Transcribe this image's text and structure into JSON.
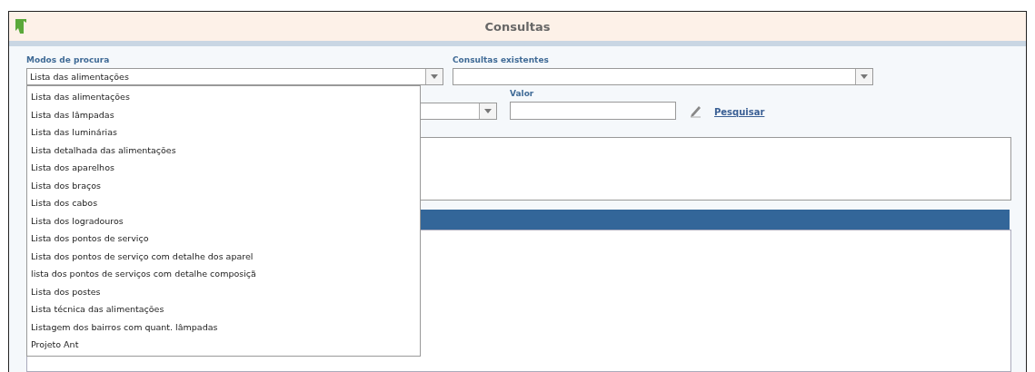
{
  "window": {
    "title": "Consultas"
  },
  "search_mode": {
    "label": "Modos de procura",
    "value": "Lista das alimentações",
    "expanded": true,
    "options": [
      {
        "label": "Lista das alimentações"
      },
      {
        "label": "Lista das lâmpadas"
      },
      {
        "label": "Lista das luminárias"
      },
      {
        "label": "Lista detalhada das alimentações"
      },
      {
        "label": "Lista dos aparelhos"
      },
      {
        "label": "Lista dos braços"
      },
      {
        "label": "Lista dos cabos"
      },
      {
        "label": "Lista dos logradouros"
      },
      {
        "label": "Lista dos pontos de serviço"
      },
      {
        "label": "Lista dos pontos de serviço com detalhe dos aparel"
      },
      {
        "label": "lista dos pontos de serviços com detalhe composiçã"
      },
      {
        "label": "Lista dos postes"
      },
      {
        "label": "Lista técnica das alimentações"
      },
      {
        "label": "Listagem dos bairros com quant. lâmpadas"
      },
      {
        "label": "Projeto Ant"
      }
    ]
  },
  "existing_queries": {
    "label": "Consultas existentes"
  },
  "value": {
    "label": "Valor"
  },
  "search_link": "Pesquisar"
}
